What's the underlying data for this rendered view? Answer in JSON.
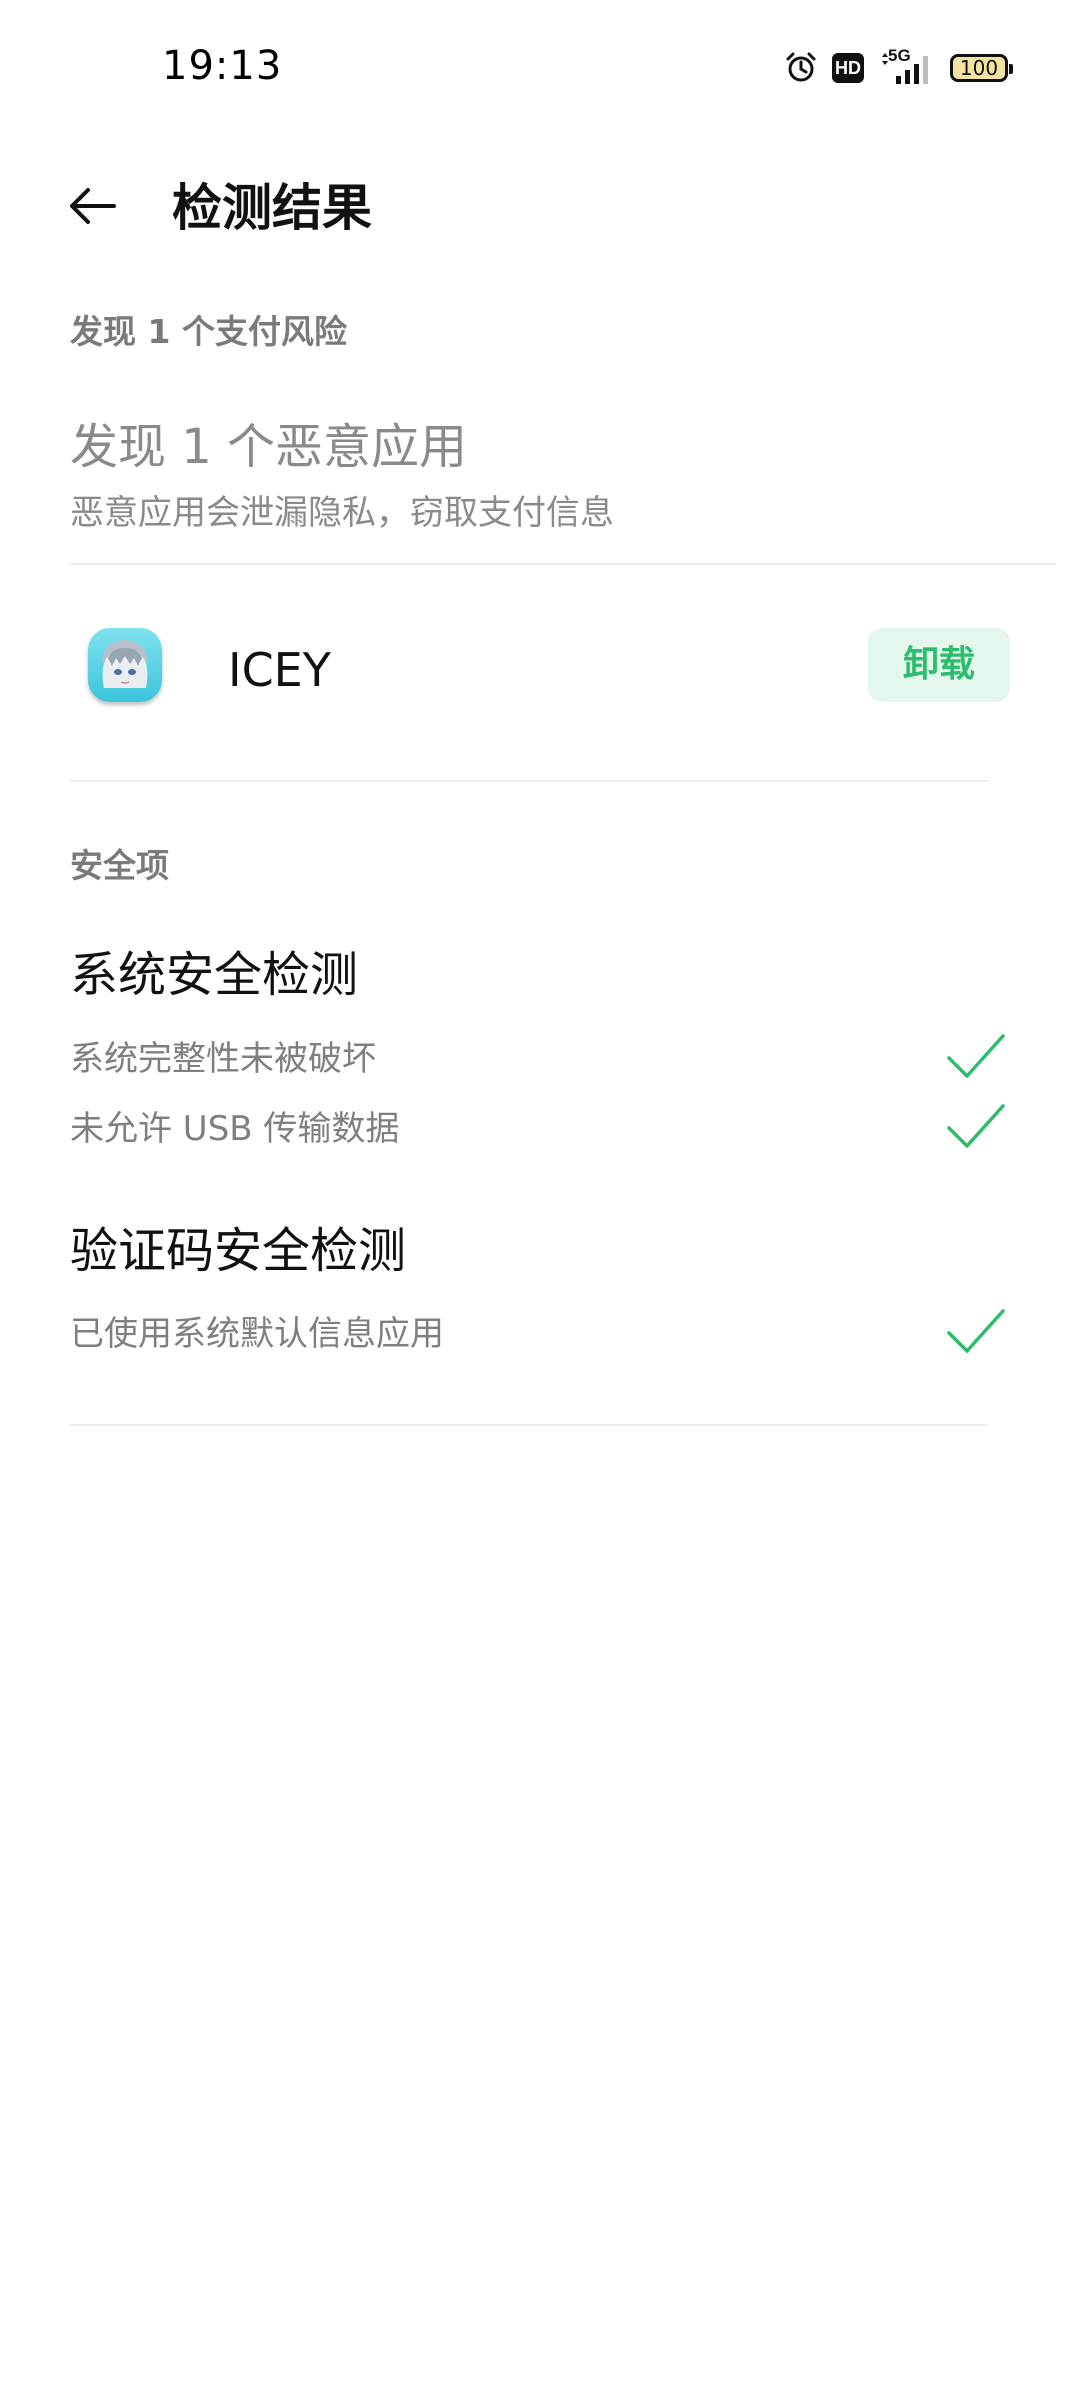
{
  "status_bar": {
    "time": "19:13",
    "network": "5G",
    "hd_label": "HD",
    "battery": "100",
    "icons": [
      "alarm-icon",
      "hd-icon",
      "5g-signal-icon",
      "battery-icon"
    ]
  },
  "header": {
    "title": "检测结果",
    "back_icon": "arrow-left-icon"
  },
  "payment_risk": {
    "section_label": "发现 1 个支付风险",
    "title": "发现 1 个恶意应用",
    "subtitle": "恶意应用会泄漏隐私，窃取支付信息",
    "apps": [
      {
        "name": "ICEY",
        "action_label": "卸载"
      }
    ]
  },
  "security": {
    "section_label": "安全项",
    "groups": [
      {
        "title": "系统安全检测",
        "items": [
          {
            "label": "系统完整性未被破坏",
            "status": "passed"
          },
          {
            "label": "未允许 USB 传输数据",
            "status": "passed"
          }
        ]
      },
      {
        "title": "验证码安全检测",
        "items": [
          {
            "label": "已使用系统默认信息应用",
            "status": "passed"
          }
        ]
      }
    ]
  },
  "colors": {
    "accent_green": "#2dbd6e",
    "button_bg": "#e3f7ec",
    "check_green": "#2bbd6a",
    "secondary_text": "#8a8a8a"
  }
}
